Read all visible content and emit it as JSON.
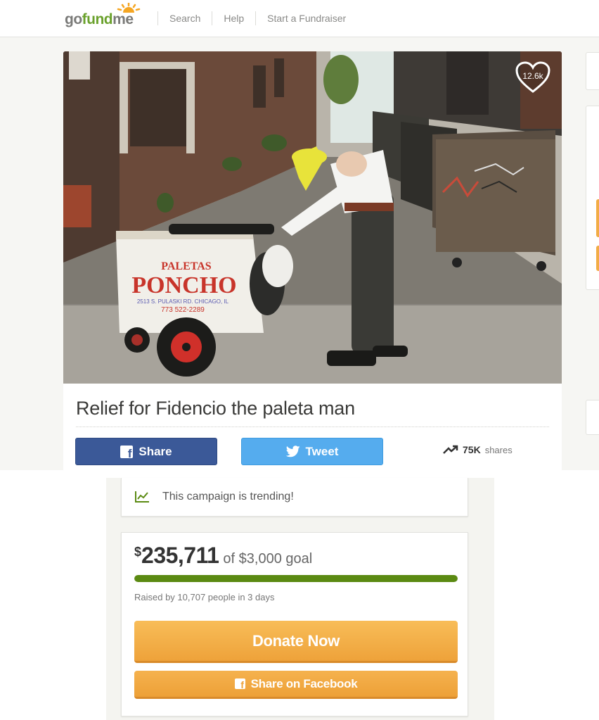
{
  "header": {
    "logo": {
      "part1": "go",
      "part2": "fund",
      "part3": "me"
    },
    "nav": [
      {
        "label": "Search"
      },
      {
        "label": "Help"
      },
      {
        "label": "Start a Fundraiser"
      }
    ]
  },
  "campaign": {
    "favorites_count": "12.6k",
    "title": "Relief for Fidencio the paleta man",
    "hero_photo": {
      "cart_label_line1": "PALETAS",
      "cart_label_line2": "PONCHO",
      "cart_address": "2513 S. PULASKI RD. CHICAGO, IL",
      "cart_phone": "773 522-2289"
    },
    "share_button": "Share",
    "tweet_button": "Tweet",
    "shares_count": "75K",
    "shares_label": "shares"
  },
  "trending": {
    "text": "This campaign is trending!"
  },
  "donation": {
    "currency_symbol": "$",
    "raised_amount": "235,711",
    "goal_text": "of $3,000 goal",
    "progress_fraction": 1.0,
    "raised_by_text": "Raised by 10,707 people in 3 days",
    "donate_button": "Donate Now",
    "facebook_button": "Share on Facebook"
  },
  "colors": {
    "facebook_blue": "#3b5998",
    "twitter_blue": "#55acee",
    "donate_orange": "#f2ac45",
    "progress_green": "#5b8a12",
    "brand_green": "#6aa12c"
  }
}
